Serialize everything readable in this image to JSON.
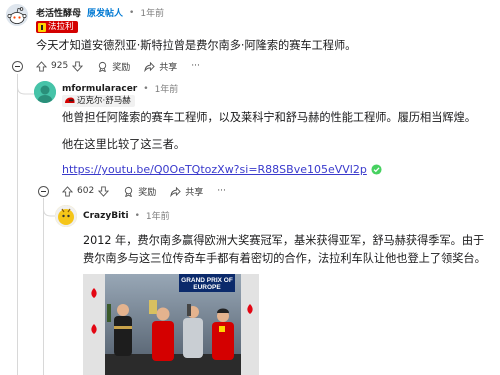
{
  "c1": {
    "author": "老活性酵母",
    "op_label": "原发帖人",
    "separator": "•",
    "time": "1年前",
    "flair": "法拉利",
    "text": "今天才知道安德烈亚·斯特拉曾是费尔南多·阿隆索的赛车工程师。",
    "votes": "925",
    "award_label": "奖励",
    "share_label": "共享",
    "more_label": "···"
  },
  "c2": {
    "author": "mformularacer",
    "separator": "•",
    "time": "1年前",
    "flair": "迈克尔·舒马赫",
    "text1": "他曾担任阿隆索的赛车工程师，以及莱科宁和舒马赫的性能工程师。履历相当辉煌。",
    "text2": "他在这里比较了这三者。",
    "link": "https://youtu.be/Q0OeTQtozXw?si=R88SBve105eVVl2p",
    "votes": "602",
    "award_label": "奖励",
    "share_label": "共享",
    "more_label": "···"
  },
  "c3": {
    "author": "CrazyBiti",
    "separator": "•",
    "time": "1年前",
    "text": "2012 年，费尔南多赢得欧洲大奖赛冠军，基米获得亚军，舒马赫获得季军。由于费尔南多与这三位传奇车手都有着密切的合作，法拉利车队让他也登上了领奖台。",
    "photo_banner": "GRAND PRIX OF EUROPE"
  },
  "colors": {
    "accent": "#0079d3",
    "ferrari_red": "#d40000",
    "link": "#3a3acc",
    "verified": "#46d160"
  }
}
